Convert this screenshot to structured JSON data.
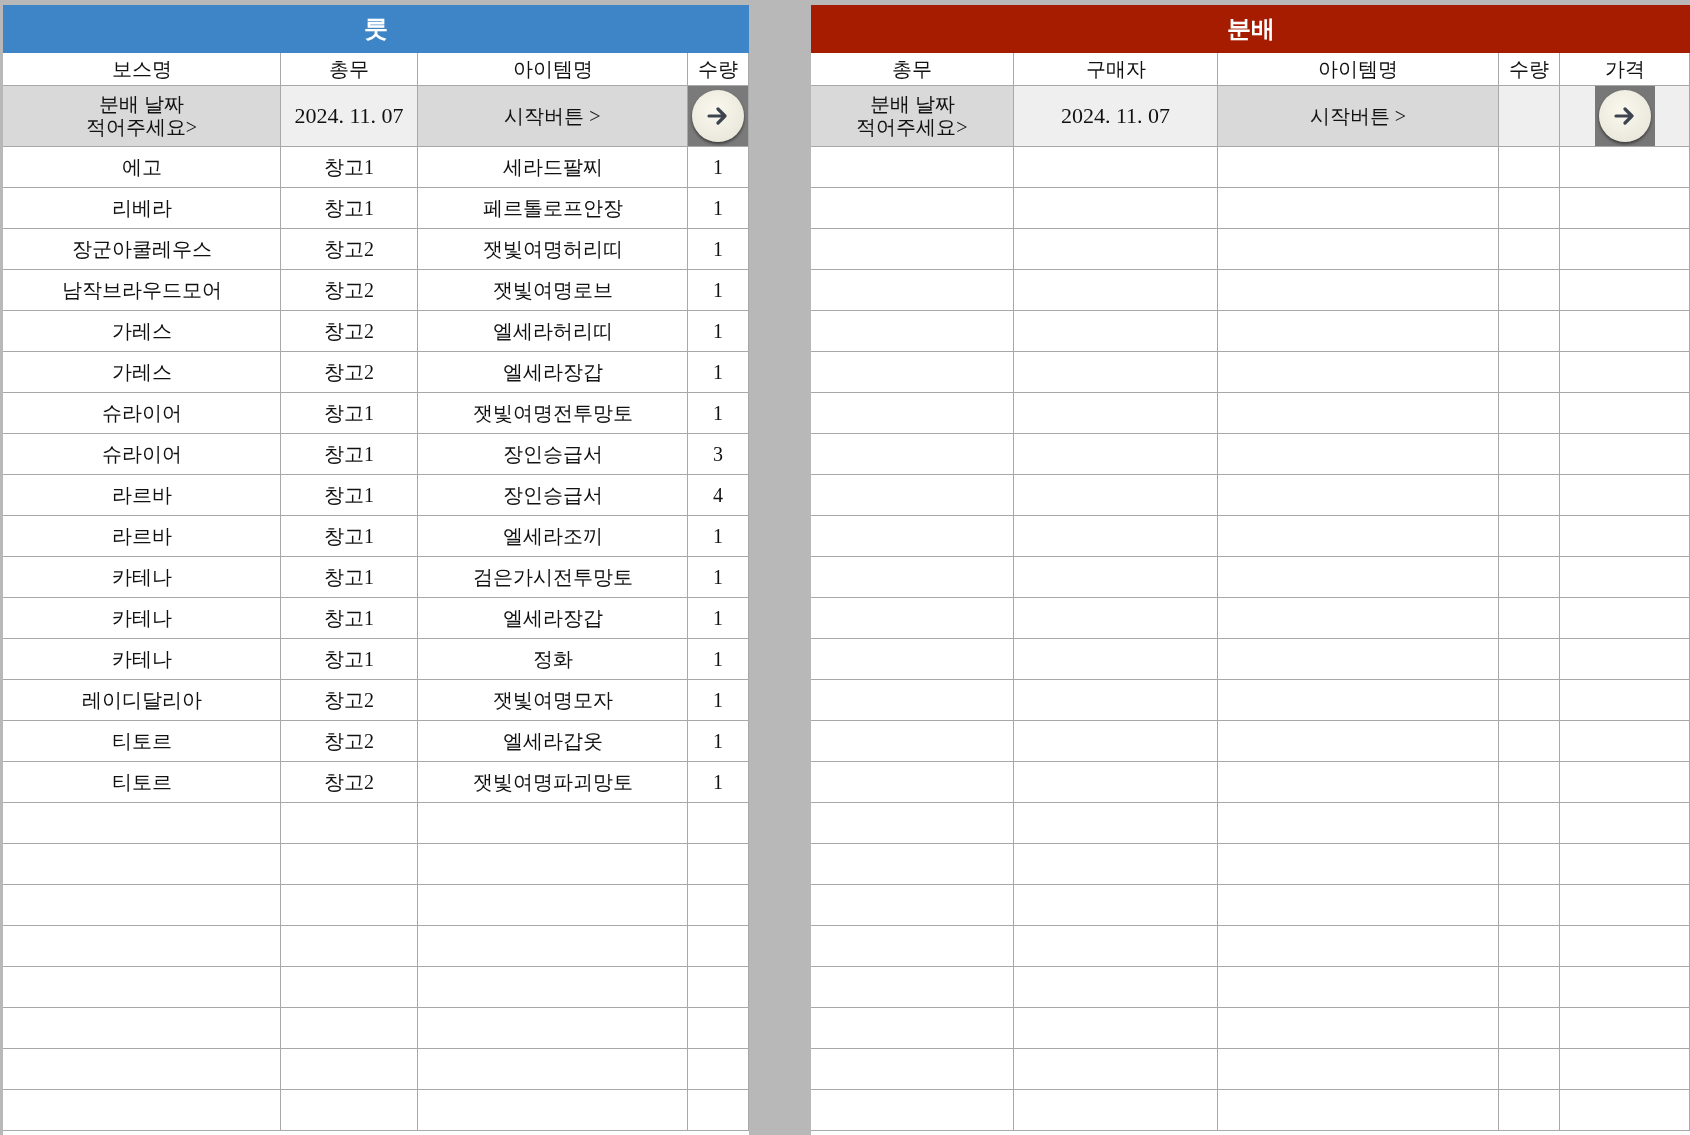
{
  "loot": {
    "title": "룻",
    "columns": [
      "보스명",
      "총무",
      "아이템명",
      "수량"
    ],
    "date_row": {
      "prompt": "분배 날짜\n적어주세요>",
      "date": "2024. 11. 07",
      "start": "시작버튼 >"
    },
    "rows": [
      {
        "boss": "에고",
        "manager": "창고1",
        "item": "세라드팔찌",
        "qty": "1"
      },
      {
        "boss": "리베라",
        "manager": "창고1",
        "item": "페르톨로프안장",
        "qty": "1"
      },
      {
        "boss": "장군아쿨레우스",
        "manager": "창고2",
        "item": "잿빛여명허리띠",
        "qty": "1"
      },
      {
        "boss": "남작브라우드모어",
        "manager": "창고2",
        "item": "잿빛여명로브",
        "qty": "1"
      },
      {
        "boss": "가레스",
        "manager": "창고2",
        "item": "엘세라허리띠",
        "qty": "1"
      },
      {
        "boss": "가레스",
        "manager": "창고2",
        "item": "엘세라장갑",
        "qty": "1"
      },
      {
        "boss": "슈라이어",
        "manager": "창고1",
        "item": "잿빛여명전투망토",
        "qty": "1"
      },
      {
        "boss": "슈라이어",
        "manager": "창고1",
        "item": "장인승급서",
        "qty": "3"
      },
      {
        "boss": "라르바",
        "manager": "창고1",
        "item": "장인승급서",
        "qty": "4"
      },
      {
        "boss": "라르바",
        "manager": "창고1",
        "item": "엘세라조끼",
        "qty": "1"
      },
      {
        "boss": "카테나",
        "manager": "창고1",
        "item": "검은가시전투망토",
        "qty": "1"
      },
      {
        "boss": "카테나",
        "manager": "창고1",
        "item": "엘세라장갑",
        "qty": "1"
      },
      {
        "boss": "카테나",
        "manager": "창고1",
        "item": "정화",
        "qty": "1"
      },
      {
        "boss": "레이디달리아",
        "manager": "창고2",
        "item": "잿빛여명모자",
        "qty": "1"
      },
      {
        "boss": "티토르",
        "manager": "창고2",
        "item": "엘세라갑옷",
        "qty": "1"
      },
      {
        "boss": "티토르",
        "manager": "창고2",
        "item": "잿빛여명파괴망토",
        "qty": "1"
      }
    ]
  },
  "distribution": {
    "title": "분배",
    "columns": [
      "총무",
      "구매자",
      "아이템명",
      "수량",
      "가격"
    ],
    "date_row": {
      "prompt": "분배 날짜\n적어주세요>",
      "date": "2024. 11. 07",
      "start": "시작버튼 >"
    }
  }
}
